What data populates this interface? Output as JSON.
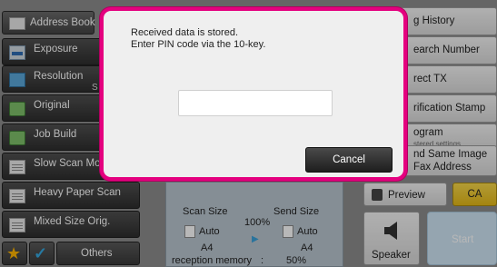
{
  "left_menu": {
    "address_book": "Address Book",
    "exposure": "Exposure",
    "resolution": "Resolution",
    "resolution_sub": "S",
    "original": "Original",
    "job_build": "Job Build",
    "slow_scan": "Slow Scan Mo",
    "heavy_paper": "Heavy Paper Scan",
    "mixed_size": "Mixed Size Orig.",
    "others": "Others"
  },
  "right_menu": {
    "sending_history": "g History",
    "search_number": "earch Number",
    "direct_tx": "rect TX",
    "verification_stamp": "rification Stamp",
    "program": "ogram",
    "program_sub": "stered settings",
    "send_same_image_1": "nd Same Image",
    "send_same_image_2": "Fax Address"
  },
  "status": {
    "scan_size_label": "Scan Size",
    "send_size_label": "Send Size",
    "scan_size_value": "Auto",
    "send_size_value": "Auto",
    "scan_paper": "A4",
    "send_paper": "A4",
    "ratio": "100%",
    "memory_label": "reception memory",
    "memory_sep": ":",
    "memory_value": "50%"
  },
  "actions": {
    "preview": "Preview",
    "ca": "CA",
    "speaker": "Speaker",
    "start": "Start"
  },
  "dialog": {
    "line1": "Received data is stored.",
    "line2": "Enter PIN code via the 10-key.",
    "pin_value": "",
    "cancel": "Cancel"
  },
  "colors": {
    "dialog_border": "#e4007f",
    "ca_button": "#f0c830",
    "start_button": "#cfe5f4"
  },
  "icons": {
    "address_book": "address-book-icon",
    "favorite": "star-icon",
    "check": "checkmark-icon",
    "preview": "preview-icon",
    "speaker": "speaker-icon"
  }
}
